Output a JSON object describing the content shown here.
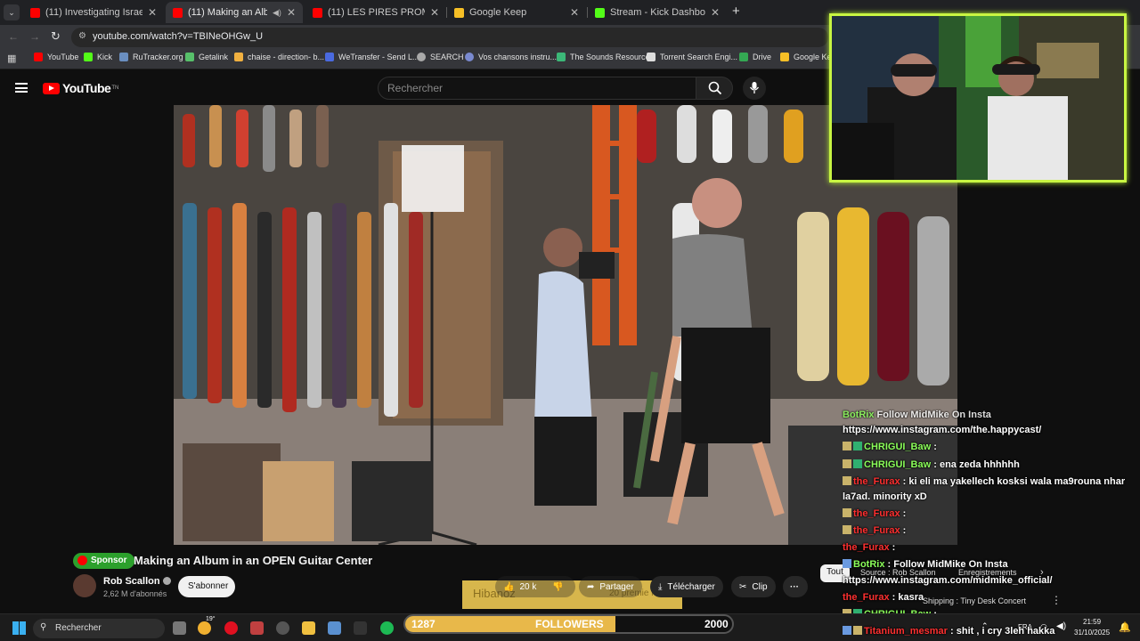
{
  "browser": {
    "tabs": [
      {
        "title": "(11) Investigating Israeli Influen",
        "icon": "youtube-icon"
      },
      {
        "title": "(11) Making an Album in an",
        "icon": "youtube-icon",
        "active": true
      },
      {
        "title": "(11) LES PIRES PROMOS D'ART",
        "icon": "youtube-icon"
      },
      {
        "title": "Google Keep",
        "icon": "keep-icon"
      },
      {
        "title": "Stream - Kick Dashboard",
        "icon": "kick-icon"
      }
    ],
    "new_tab": "+",
    "url": "youtube.com/watch?v=TBINeOHGw_U",
    "bookmarks": [
      "YouTube",
      "Kick",
      "RuTracker.org",
      "Getalink",
      "chaise - direction- b...",
      "WeTransfer - Send L...",
      "SEARCH",
      "Vos chansons instru...",
      "The Sounds Resource",
      "Torrent Search Engi...",
      "Drive",
      "Google Keep"
    ]
  },
  "youtube": {
    "logo": "YouTube",
    "logo_sup": "TN",
    "search_placeholder": "Rechercher"
  },
  "video": {
    "sponsor": "Sponsor",
    "title": "Making an Album in an OPEN Guitar Center",
    "channel": "Rob Scallon",
    "subscribers": "2,62 M d'abonnés",
    "subscribe": "S'abonner",
    "likes": "20 k",
    "share": "Partager",
    "download": "Télécharger",
    "clip": "Clip"
  },
  "chat": [
    {
      "name": "BotRix",
      "msg": "Follow MidMike On Insta",
      "name_color": "green"
    },
    {
      "name": "",
      "msg": "https://www.instagram.com/the.happycast/"
    },
    {
      "name": "CHRIGUI_Baw",
      "msg": ":",
      "name_color": "green"
    },
    {
      "name": "CHRIGUI_Baw",
      "msg": ": ena zeda hhhhhh",
      "name_color": "green"
    },
    {
      "name": "the_Furax",
      "msg": ": ki eli ma yakellech kosksi wala ma9rouna nhar",
      "name_color": "red"
    },
    {
      "name": "",
      "msg": "la7ad. minority xD"
    },
    {
      "name": "the_Furax",
      "msg": ":",
      "name_color": "red"
    },
    {
      "name": "the_Furax",
      "msg": ":",
      "name_color": "red"
    },
    {
      "name": "the_Furax",
      "msg": ":",
      "name_color": "red"
    },
    {
      "name": "BotRix",
      "msg": ": Follow MidMike On Insta",
      "name_color": "green"
    },
    {
      "name": "",
      "msg": "https://www.instagram.com/midmike_official/"
    },
    {
      "name": "the_Furax",
      "msg": ": kasra",
      "name_color": "red"
    },
    {
      "name": "CHRIGUI_Baw",
      "msg": ":",
      "name_color": "green"
    },
    {
      "name": "Titanium_mesmar",
      "msg": ": shit , i cry 3leh hakka",
      "name_color": "red"
    }
  ],
  "overlay_labels": {
    "tout": "Tout",
    "source": "Source : Rob Scallon",
    "saved": "Enregistrements",
    "tiny_desk": "Shipping : Tiny Desk Concert"
  },
  "hiban": {
    "text": "Hibanoz",
    "sub": "20 premie rs"
  },
  "followers": {
    "current": "1287",
    "label": "FOLLOWERS",
    "goal": "2000",
    "progress": 0.6435
  },
  "taskbar": {
    "search": "Rechercher",
    "weather": "19°",
    "lang": "FRA",
    "time": "21:59",
    "date": "31/10/2025"
  },
  "colors": {
    "accent": "#c8f542",
    "youtube_red": "#ff0000",
    "followers_fill": "#e8b84a",
    "sponsor": "#2ca02c"
  }
}
